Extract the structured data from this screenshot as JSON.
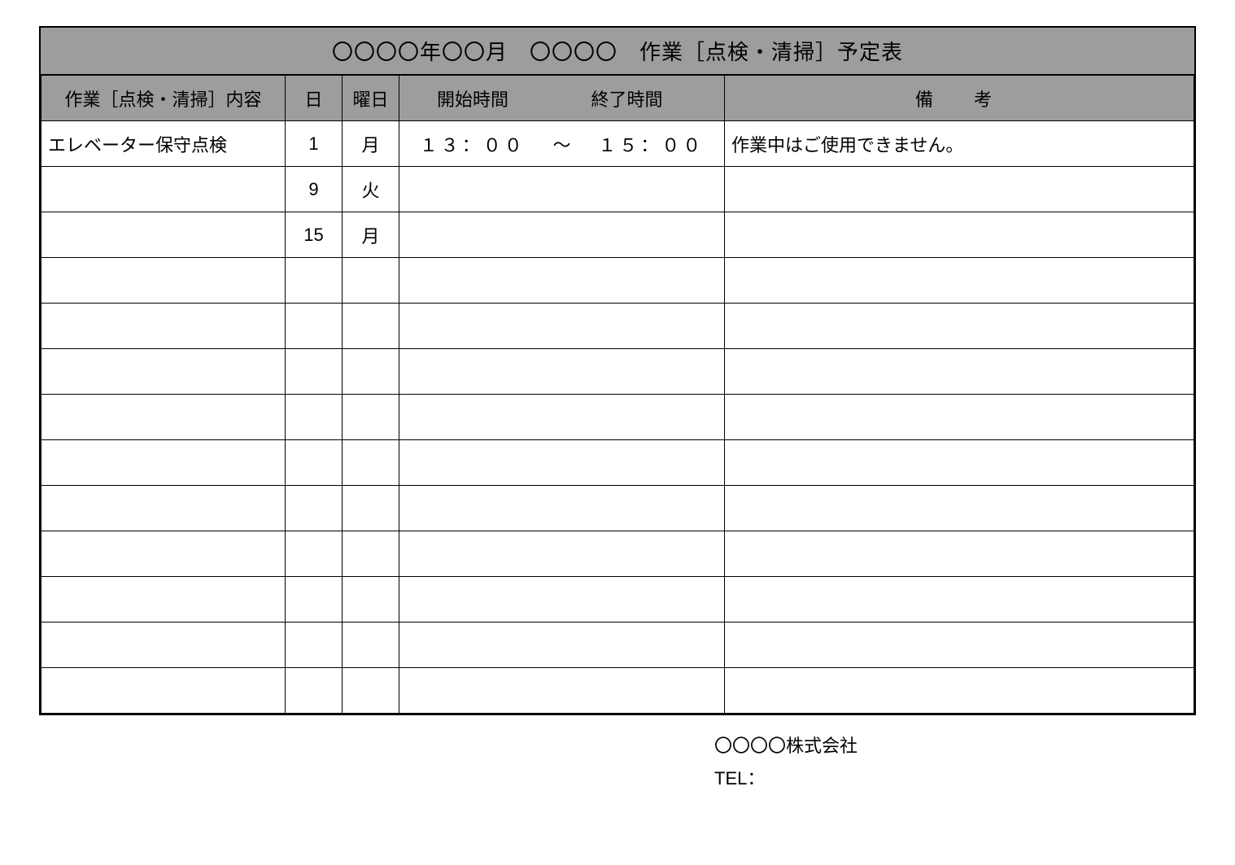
{
  "title": "〇〇〇〇年〇〇月　〇〇〇〇　作業［点検・清掃］予定表",
  "headers": {
    "content": "作業［点検・清掃］内容",
    "day": "日",
    "weekday": "曜日",
    "start": "開始時間",
    "end": "終了時間",
    "note": "備　考"
  },
  "rows": [
    {
      "content": "エレベーター保守点検",
      "day": "1",
      "weekday": "月",
      "start": "１３：００",
      "sep": "～",
      "end": "１５：００",
      "note": "作業中はご使用できません。"
    },
    {
      "content": "",
      "day": "9",
      "weekday": "火",
      "start": "",
      "sep": "",
      "end": "",
      "note": ""
    },
    {
      "content": "",
      "day": "15",
      "weekday": "月",
      "start": "",
      "sep": "",
      "end": "",
      "note": ""
    },
    {
      "content": "",
      "day": "",
      "weekday": "",
      "start": "",
      "sep": "",
      "end": "",
      "note": ""
    },
    {
      "content": "",
      "day": "",
      "weekday": "",
      "start": "",
      "sep": "",
      "end": "",
      "note": ""
    },
    {
      "content": "",
      "day": "",
      "weekday": "",
      "start": "",
      "sep": "",
      "end": "",
      "note": ""
    },
    {
      "content": "",
      "day": "",
      "weekday": "",
      "start": "",
      "sep": "",
      "end": "",
      "note": ""
    },
    {
      "content": "",
      "day": "",
      "weekday": "",
      "start": "",
      "sep": "",
      "end": "",
      "note": ""
    },
    {
      "content": "",
      "day": "",
      "weekday": "",
      "start": "",
      "sep": "",
      "end": "",
      "note": ""
    },
    {
      "content": "",
      "day": "",
      "weekday": "",
      "start": "",
      "sep": "",
      "end": "",
      "note": ""
    },
    {
      "content": "",
      "day": "",
      "weekday": "",
      "start": "",
      "sep": "",
      "end": "",
      "note": ""
    },
    {
      "content": "",
      "day": "",
      "weekday": "",
      "start": "",
      "sep": "",
      "end": "",
      "note": ""
    },
    {
      "content": "",
      "day": "",
      "weekday": "",
      "start": "",
      "sep": "",
      "end": "",
      "note": ""
    }
  ],
  "footer": {
    "company": "〇〇〇〇株式会社",
    "tel_label": "TEL："
  }
}
